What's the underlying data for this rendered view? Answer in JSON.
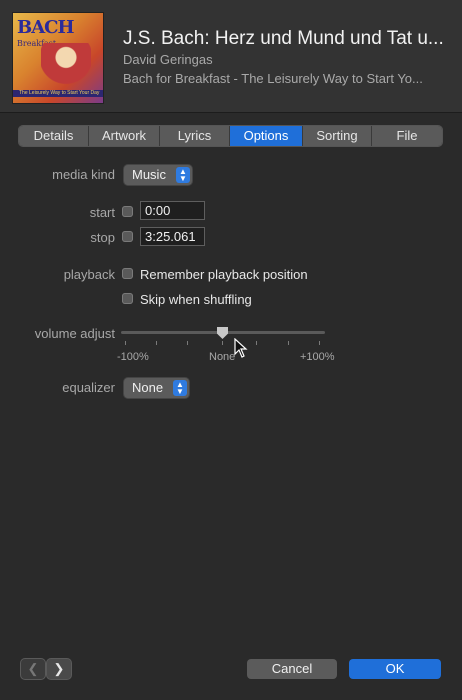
{
  "header": {
    "title": "J.S. Bach: Herz und Mund und Tat u...",
    "artist": "David Geringas",
    "album": "Bach for Breakfast - The Leisurely Way to Start Yo...",
    "artwork_text": "BACH",
    "artwork_subtext": "Breakfast",
    "artwork_strip": "The Leisurely Way to Start Your Day"
  },
  "tabs": [
    {
      "label": "Details",
      "active": false
    },
    {
      "label": "Artwork",
      "active": false
    },
    {
      "label": "Lyrics",
      "active": false
    },
    {
      "label": "Options",
      "active": true
    },
    {
      "label": "Sorting",
      "active": false
    },
    {
      "label": "File",
      "active": false
    }
  ],
  "options": {
    "media_kind_label": "media kind",
    "media_kind_value": "Music",
    "start_label": "start",
    "start_value": "0:00",
    "start_checked": false,
    "stop_label": "stop",
    "stop_value": "3:25.061",
    "stop_checked": false,
    "playback_label": "playback",
    "remember_label": "Remember playback position",
    "remember_checked": false,
    "skip_label": "Skip when shuffling",
    "skip_checked": false,
    "volume_label": "volume adjust",
    "volume_min": "-100%",
    "volume_mid": "None",
    "volume_max": "+100%",
    "volume_value": 0,
    "equalizer_label": "equalizer",
    "equalizer_value": "None"
  },
  "footer": {
    "prev_icon": "chevron-left-icon",
    "next_icon": "chevron-right-icon",
    "prev_glyph": "❮",
    "next_glyph": "❯",
    "cancel_label": "Cancel",
    "ok_label": "OK"
  },
  "colors": {
    "accent": "#1f6fd9",
    "background": "#2a2a2a"
  }
}
